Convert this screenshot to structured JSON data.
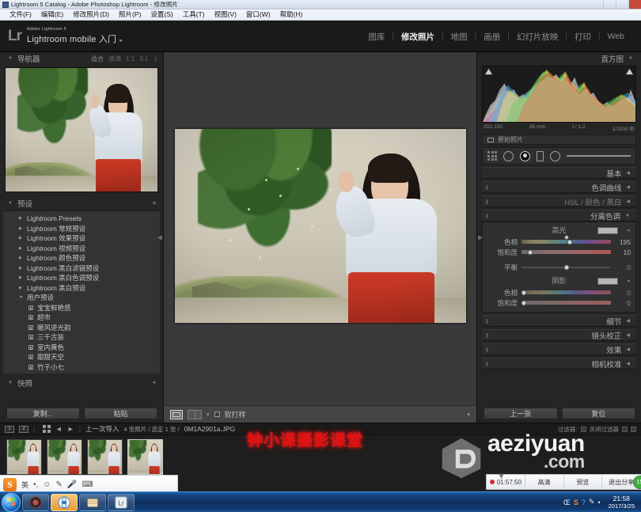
{
  "window": {
    "title": "Lightroom 5 Catalog - Adobe Photoshop Lightroom - 修改照片",
    "icon": "lightroom-icon",
    "minimize": "minimize-icon",
    "maximize": "maximize-icon",
    "close": "close-icon"
  },
  "menubar": {
    "items": [
      {
        "label": "文件(F)"
      },
      {
        "label": "编辑(E)"
      },
      {
        "label": "修改照片(D)"
      },
      {
        "label": "照片(P)"
      },
      {
        "label": "设置(S)"
      },
      {
        "label": "工具(T)"
      },
      {
        "label": "视图(V)"
      },
      {
        "label": "窗口(W)"
      },
      {
        "label": "帮助(H)"
      }
    ]
  },
  "identity": {
    "logo": "Lr",
    "line1": "Adobe Lightroom 5",
    "line2": "Lightroom mobile 入门",
    "arrow": "▸"
  },
  "modules": {
    "items": [
      {
        "label": "图库",
        "active": false
      },
      {
        "label": "修改照片",
        "active": true
      },
      {
        "label": "地图",
        "active": false
      },
      {
        "label": "画册",
        "active": false
      },
      {
        "label": "幻灯片放映",
        "active": false
      },
      {
        "label": "打印",
        "active": false
      },
      {
        "label": "Web",
        "active": false
      }
    ],
    "separator": "|"
  },
  "navigator": {
    "title": "导航器",
    "triangle": "▼",
    "zoom_options": [
      "适合",
      "填满",
      "1:1",
      "3:1"
    ],
    "stepper": "⇳"
  },
  "presets": {
    "title": "预设",
    "triangle": "▼",
    "add": "+",
    "groups": [
      {
        "label": "Lightroom Presets",
        "triangle": "▶"
      },
      {
        "label": "Lightroom 常规预设",
        "triangle": "▶"
      },
      {
        "label": "Lightroom 效果预设",
        "triangle": "▶"
      },
      {
        "label": "Lightroom 视频预设",
        "triangle": "▶"
      },
      {
        "label": "Lightroom 颜色预设",
        "triangle": "▶"
      },
      {
        "label": "Lightroom 黑白滤镜预设",
        "triangle": "▶"
      },
      {
        "label": "Lightroom 黑白色调预设",
        "triangle": "▶"
      },
      {
        "label": "Lightroom 黑白预设",
        "triangle": "▶"
      },
      {
        "label": "用户预设",
        "triangle": "▼"
      }
    ],
    "user_presets": [
      {
        "label": "宝宝鲜艳感"
      },
      {
        "label": "超市"
      },
      {
        "label": "暖风逆光韵"
      },
      {
        "label": "三千古装"
      },
      {
        "label": "室内黄色"
      },
      {
        "label": "甜甜天空"
      },
      {
        "label": "竹子小七"
      }
    ]
  },
  "snapshots": {
    "title": "快照",
    "triangle": "▼",
    "add": "+"
  },
  "left_buttons": {
    "copy": "复制...",
    "paste": "粘贴"
  },
  "histogram": {
    "title": "直方图",
    "triangle": "▼",
    "iso": "ISO 100",
    "focal": "85 mm",
    "aperture": "f / 1.2",
    "shutter": "1/1000 秒"
  },
  "original_photo": {
    "label": "原始照片",
    "icon": "rectangle-icon"
  },
  "toolstrip": {
    "icons": [
      {
        "name": "grid-icon"
      },
      {
        "name": "crop-circle-icon"
      },
      {
        "name": "spot-removal-icon"
      },
      {
        "name": "red-eye-icon"
      },
      {
        "name": "graduated-filter-icon"
      },
      {
        "name": "adjustment-brush-icon"
      }
    ]
  },
  "panels": [
    {
      "label": "基本",
      "caret": "◀",
      "expanded": false
    },
    {
      "label": "色调曲线",
      "caret": "◀",
      "expanded": false
    },
    {
      "label": "HSL / 颜色 / 黑白",
      "caret": "◀",
      "expanded": false
    }
  ],
  "split_tone": {
    "title": "分离色调",
    "caret": "▼",
    "highlights": {
      "label": "高光",
      "swatch": "#b6b6b6",
      "caret": "▾",
      "hue": {
        "label": "色相",
        "value": "195",
        "pos": 54
      },
      "saturation": {
        "label": "饱和度",
        "value": "10",
        "pos": 10
      }
    },
    "balance": {
      "label": "平衡",
      "value": "0",
      "pos": 50
    },
    "shadows": {
      "label": "阴影",
      "swatch": "#b6b6b6",
      "caret": "▾",
      "hue": {
        "label": "色相",
        "value": "0",
        "pos": 3
      },
      "saturation": {
        "label": "饱和度",
        "value": "0",
        "pos": 3
      }
    }
  },
  "panels_lower": [
    {
      "label": "细节",
      "caret": "◀"
    },
    {
      "label": "镜头校正",
      "caret": "◀"
    },
    {
      "label": "效果",
      "caret": "◀"
    },
    {
      "label": "相机校准",
      "caret": "◀"
    }
  ],
  "right_buttons": {
    "previous": "上一张",
    "reset": "复位"
  },
  "toolbar": {
    "loupe_icon": "loupe-view-icon",
    "compare_icon": "compare-view-icon",
    "caret": "▾",
    "soft_proof_label": "软打样",
    "right_caret": "▾"
  },
  "filmstrip": {
    "monitor1": "1",
    "monitor2": "2",
    "grid_icon": "grid-view-icon",
    "back_arrow": "◄",
    "forward_arrow": "►",
    "source": "上一次导入",
    "stats": "4 张照片 / 选定 1 张 /",
    "filename": "0M1A2901a.JPG",
    "filter_label": "过滤器:",
    "filter_value": "关闭过滤器",
    "thumbs": [
      {
        "name": "thumb-1"
      },
      {
        "name": "thumb-2"
      },
      {
        "name": "thumb-3"
      },
      {
        "name": "thumb-4",
        "selected": true
      }
    ]
  },
  "overlay": {
    "caption": "钟小课摄影课堂",
    "caption_color": "#e01010"
  },
  "watermark": {
    "logo": "cube-logo",
    "text1": "aeziyuan",
    "text2": ".com"
  },
  "recorder": {
    "record_icon": "record-dot-icon",
    "time": "01:57:50",
    "quality": "高清",
    "preview": "预览",
    "exit": "退出分享",
    "badge": "15"
  },
  "ime": {
    "logo": "S",
    "mode": "英",
    "items": [
      "•,",
      "☺",
      "✎",
      "🎤",
      "⌨"
    ]
  },
  "taskbar": {
    "start": "start-orb-icon",
    "buttons": [
      {
        "name": "media-player-icon"
      },
      {
        "name": "browser-icon",
        "active": true
      },
      {
        "name": "explorer-icon"
      },
      {
        "name": "lightroom-icon",
        "label": "Lr"
      }
    ],
    "tray": [
      "Œ",
      "S",
      "?",
      "✎",
      "•"
    ],
    "clock_time": "21:58",
    "clock_date": "2017/3/25"
  }
}
